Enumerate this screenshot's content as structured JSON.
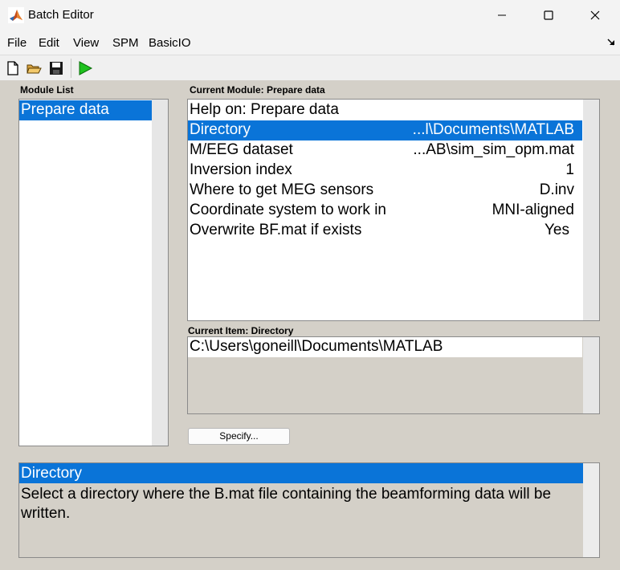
{
  "window": {
    "title": "Batch Editor",
    "minimize_icon": "minimize-icon",
    "maximize_icon": "maximize-icon",
    "close_icon": "close-icon"
  },
  "menu": {
    "items": [
      {
        "label": "File"
      },
      {
        "label": "Edit"
      },
      {
        "label": "View"
      },
      {
        "label": "SPM"
      },
      {
        "label": "BasicIO"
      }
    ],
    "overflow_icon": "menu-overflow-arrow-icon"
  },
  "toolbar": {
    "icons": [
      "new-file-icon",
      "open-folder-icon",
      "save-icon",
      "run-icon"
    ]
  },
  "module_list": {
    "label": "Module List",
    "items": [
      {
        "label": "Prepare data",
        "selected": true
      }
    ]
  },
  "current_module": {
    "label": "Current Module: Prepare data",
    "rows": [
      {
        "name": "Help on: Prepare data",
        "value": ""
      },
      {
        "name": "Directory",
        "value": "...l\\Documents\\MATLAB",
        "selected": true
      },
      {
        "name": "M/EEG dataset",
        "value": "...AB\\sim_sim_opm.mat"
      },
      {
        "name": "Inversion index",
        "value": "1"
      },
      {
        "name": "Where to get MEG sensors",
        "value": "D.inv"
      },
      {
        "name": "Coordinate system to work in",
        "value": "MNI-aligned"
      },
      {
        "name": "Overwrite BF.mat if exists",
        "value": "Yes"
      }
    ]
  },
  "current_item": {
    "label": "Current Item: Directory",
    "value": "C:\\Users\\goneill\\Documents\\MATLAB",
    "specify_button": "Specify..."
  },
  "help": {
    "title": "Directory",
    "text": "Select a directory where the B.mat file containing the beamforming data will be written."
  },
  "colors": {
    "selection": "#0a74d8",
    "panel_bg": "#d4d0c8",
    "run_green": "#1fc21f"
  }
}
